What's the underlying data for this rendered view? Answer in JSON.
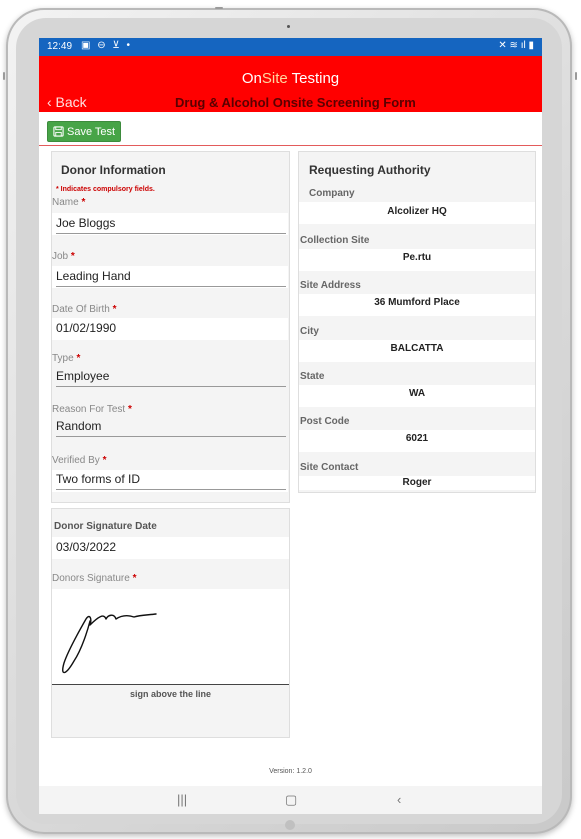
{
  "statusbar": {
    "time": "12:49",
    "left_icons": "▣ ⊖ ⊻ •",
    "right_icons": "✕ ≋ ıl ▮"
  },
  "header": {
    "brand_on": "On",
    "brand_site": "Site",
    "brand_testing": " Testing",
    "back_label": "‹ Back",
    "form_title": "Drug & Alcohol Onsite Screening Form"
  },
  "toolbar": {
    "save_label": "Save Test"
  },
  "donor_info": {
    "title": "Donor Information",
    "note": "* Indicates compulsory fields.",
    "required_marker": "*",
    "fields": [
      {
        "label": "Name",
        "value": "Joe Bloggs"
      },
      {
        "label": "Job",
        "value": "Leading Hand"
      },
      {
        "label": "Date Of Birth",
        "value": "01/02/1990"
      },
      {
        "label": "Type",
        "value": "Employee"
      },
      {
        "label": "Reason For Test",
        "value": "Random"
      },
      {
        "label": "Verified By",
        "value": "Two forms of ID"
      }
    ]
  },
  "signature": {
    "date_label": "Donor Signature Date",
    "date_value": "03/03/2022",
    "sig_label": "Donors Signature",
    "caption": "sign above the line"
  },
  "requesting_authority": {
    "title": "Requesting Authority",
    "fields": [
      {
        "label": "Company",
        "value": "Alcolizer HQ"
      },
      {
        "label": "Collection Site",
        "value": "Pe.rtu"
      },
      {
        "label": "Site Address",
        "value": "36 Mumford Place"
      },
      {
        "label": "City",
        "value": "BALCATTA"
      },
      {
        "label": "State",
        "value": "WA"
      },
      {
        "label": "Post Code",
        "value": "6021"
      },
      {
        "label": "Site Contact",
        "value": "Roger"
      }
    ]
  },
  "footer": {
    "version": "Version: 1.2.0"
  },
  "navbar": {
    "recents": "|||",
    "home": "▢",
    "back": "‹"
  },
  "colors": {
    "header_red": "#ff0000",
    "statusbar_blue": "#1565c0",
    "save_green": "#47a447",
    "required_red": "#cc0000"
  }
}
